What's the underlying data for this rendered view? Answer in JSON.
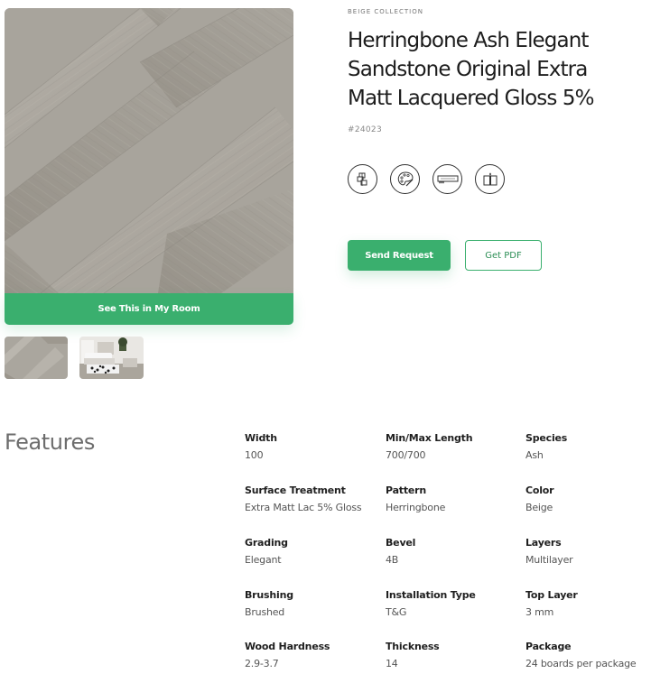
{
  "product": {
    "collection": "BEIGE COLLECTION",
    "title_line1": "Herringbone Ash Elegant",
    "title_line2": "Sandstone Original Extra",
    "title_line3": "Matt Lacquered Gloss 5%",
    "sku": "#24023"
  },
  "gallery": {
    "room_button_label": "See This in My Room",
    "thumbnails": [
      "herringbone-swatch",
      "room-scene"
    ]
  },
  "icons": [
    "layers-icon",
    "palette-icon",
    "plank-saw-icon",
    "book-icon"
  ],
  "actions": {
    "send_label": "Send Request",
    "pdf_label": "Get PDF"
  },
  "features": {
    "heading": "Features",
    "items": [
      {
        "label": "Width",
        "value": "100"
      },
      {
        "label": "Min/Max Length",
        "value": "700/700"
      },
      {
        "label": "Species",
        "value": "Ash"
      },
      {
        "label": "Surface Treatment",
        "value": "Extra Matt Lac 5% Gloss"
      },
      {
        "label": "Pattern",
        "value": "Herringbone"
      },
      {
        "label": "Color",
        "value": "Beige"
      },
      {
        "label": "Grading",
        "value": "Elegant"
      },
      {
        "label": "Bevel",
        "value": "4B"
      },
      {
        "label": "Layers",
        "value": "Multilayer"
      },
      {
        "label": "Brushing",
        "value": "Brushed"
      },
      {
        "label": "Installation Type",
        "value": "T&G"
      },
      {
        "label": "Top Layer",
        "value": "3 mm"
      },
      {
        "label": "Wood Hardness",
        "value": "2.9-3.7"
      },
      {
        "label": "Thickness",
        "value": "14"
      },
      {
        "label": "Package",
        "value": "24 boards per package"
      }
    ]
  },
  "colors": {
    "accent": "#3aaf6e",
    "wood_light": "#b3afa7",
    "wood_dark": "#9d988f"
  }
}
